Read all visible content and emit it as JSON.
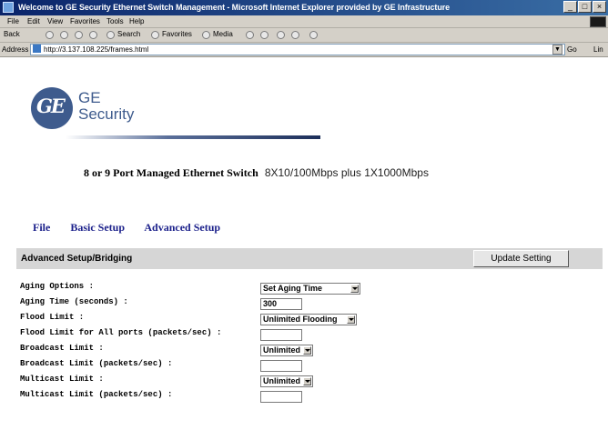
{
  "window": {
    "title": "Welcome to GE Security Ethernet Switch Management - Microsoft Internet Explorer provided by GE Infrastructure",
    "buttons": {
      "minimize": "_",
      "maximize": "□",
      "close": "×"
    }
  },
  "menu": [
    "File",
    "Edit",
    "View",
    "Favorites",
    "Tools",
    "Help"
  ],
  "toolbar": {
    "back": "Back",
    "search": "Search",
    "favorites": "Favorites",
    "media": "Media"
  },
  "address": {
    "label": "Address",
    "url": "http://3.137.108.225/frames.html",
    "go": "Go",
    "links": "Lin"
  },
  "brand": {
    "logo_text": "GE",
    "line1": "GE",
    "line2": "Security"
  },
  "product": {
    "name": "8 or 9 Port Managed Ethernet Switch",
    "spec": "8X10/100Mbps plus 1X1000Mbps"
  },
  "nav": [
    "File",
    "Basic Setup",
    "Advanced Setup"
  ],
  "section": {
    "title": "Advanced Setup/Bridging",
    "button": "Update Setting"
  },
  "form": [
    {
      "label": "Aging Options :",
      "type": "select",
      "value": "Set Aging Time"
    },
    {
      "label": "Aging Time (seconds) :",
      "type": "input",
      "value": "300"
    },
    {
      "label": "Flood Limit :",
      "type": "select",
      "value": "Unlimited Flooding"
    },
    {
      "label": "Flood Limit for All ports (packets/sec) :",
      "type": "input",
      "value": ""
    },
    {
      "label": "Broadcast Limit :",
      "type": "select",
      "value": "Unlimited"
    },
    {
      "label": "Broadcast Limit (packets/sec) :",
      "type": "input",
      "value": ""
    },
    {
      "label": "Multicast Limit :",
      "type": "select",
      "value": "Unlimited"
    },
    {
      "label": "Multicast Limit (packets/sec) :",
      "type": "input",
      "value": ""
    }
  ]
}
